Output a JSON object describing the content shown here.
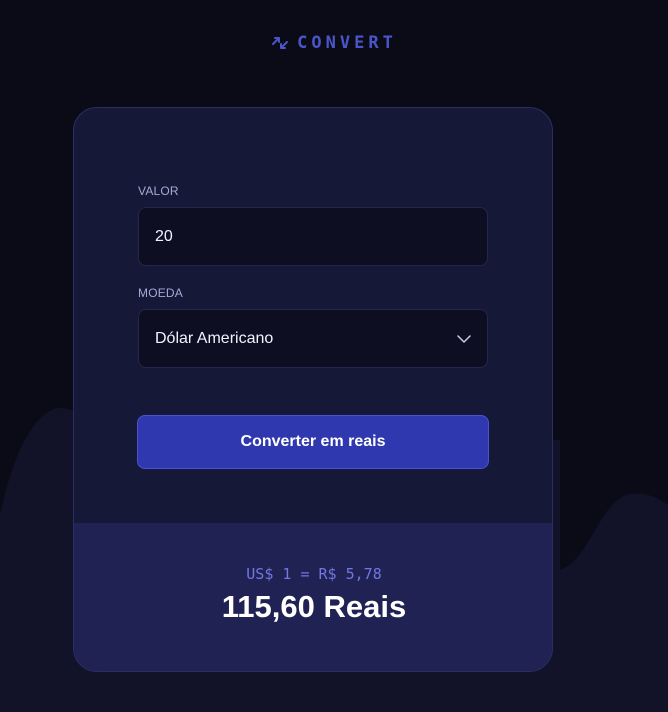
{
  "brand": {
    "name": "CONVERT",
    "icon": "arrows-exchange-icon",
    "color": "#4a55c8"
  },
  "form": {
    "amount": {
      "label": "VALOR",
      "value": "20"
    },
    "currency": {
      "label": "MOEDA",
      "selected": "Dólar Americano",
      "icon": "chevron-down-icon"
    },
    "submit_label": "Converter em reais"
  },
  "result": {
    "rate": "US$ 1 = R$ 5,78",
    "total": "115,60 Reais"
  },
  "colors": {
    "background": "#0b0b18",
    "card": "#161838",
    "result_panel": "#202253",
    "accent": "#3038b0"
  }
}
